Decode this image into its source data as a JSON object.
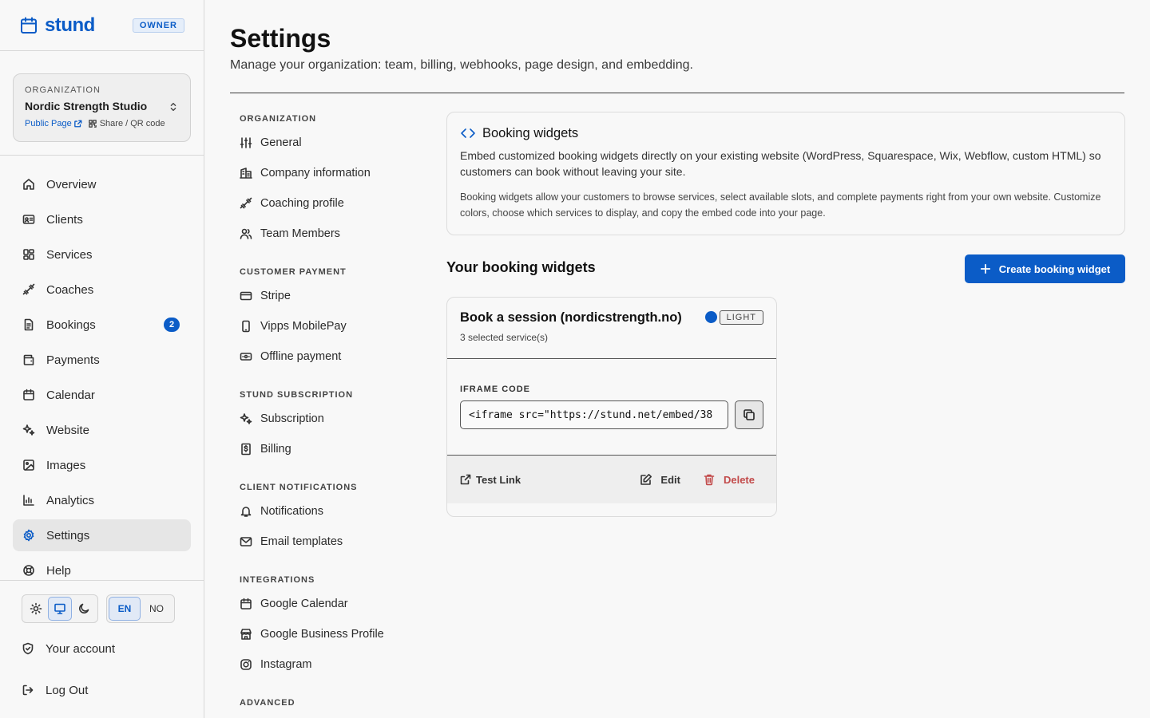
{
  "brand": {
    "name": "stund",
    "role_badge": "OWNER",
    "accent": "#0b5cc7"
  },
  "organization": {
    "label": "ORGANIZATION",
    "name": "Nordic Strength Studio",
    "public_page": "Public Page",
    "share": "Share / QR code"
  },
  "nav": {
    "items": [
      {
        "label": "Overview",
        "icon": "home-icon"
      },
      {
        "label": "Clients",
        "icon": "id-card-icon"
      },
      {
        "label": "Services",
        "icon": "grid-icon"
      },
      {
        "label": "Coaches",
        "icon": "dumbbell-icon"
      },
      {
        "label": "Bookings",
        "icon": "document-icon",
        "badge": "2"
      },
      {
        "label": "Payments",
        "icon": "wallet-icon"
      },
      {
        "label": "Calendar",
        "icon": "calendar-icon"
      },
      {
        "label": "Website",
        "icon": "sparkles-icon"
      },
      {
        "label": "Images",
        "icon": "image-icon"
      },
      {
        "label": "Analytics",
        "icon": "bar-chart-icon"
      },
      {
        "label": "Settings",
        "icon": "gear-icon",
        "active": true
      },
      {
        "label": "Help",
        "icon": "lifebuoy-icon"
      }
    ]
  },
  "preferences": {
    "theme_selected": "system",
    "languages": [
      "EN",
      "NO"
    ],
    "language_selected": "EN"
  },
  "account": {
    "your_account": "Your account",
    "log_out": "Log Out"
  },
  "page": {
    "title": "Settings",
    "subtitle": "Manage your organization: team, billing, webhooks, page design, and embedding."
  },
  "subnav": {
    "sections": [
      {
        "title": "ORGANIZATION",
        "items": [
          "General",
          "Company information",
          "Coaching profile",
          "Team Members"
        ]
      },
      {
        "title": "CUSTOMER PAYMENT",
        "items": [
          "Stripe",
          "Vipps MobilePay",
          "Offline payment"
        ]
      },
      {
        "title": "STUND SUBSCRIPTION",
        "items": [
          "Subscription",
          "Billing"
        ]
      },
      {
        "title": "CLIENT NOTIFICATIONS",
        "items": [
          "Notifications",
          "Email templates"
        ]
      },
      {
        "title": "INTEGRATIONS",
        "items": [
          "Google Calendar",
          "Google Business Profile",
          "Instagram"
        ]
      },
      {
        "title": "ADVANCED",
        "items": []
      }
    ]
  },
  "info_card": {
    "title": "Booking widgets",
    "description": "Embed customized booking widgets directly on your existing website (WordPress, Squarespace, Wix, Webflow, custom HTML) so customers can book without leaving your site.",
    "details": "Booking widgets allow your customers to browse services, select available slots, and complete payments right from your own website. Customize colors, choose which services to display, and copy the embed code into your page."
  },
  "widgets_section": {
    "title": "Your booking widgets",
    "create_button": "Create booking widget"
  },
  "widget": {
    "name": "Book a session (nordicstrength.no)",
    "services_count": "3 selected service(s)",
    "color": "#0b5cc7",
    "theme": "LIGHT",
    "code_label": "IFRAME CODE",
    "code_value": "<iframe src=\"https://stund.net/embed/38",
    "test_link": "Test Link",
    "edit": "Edit",
    "delete": "Delete"
  }
}
